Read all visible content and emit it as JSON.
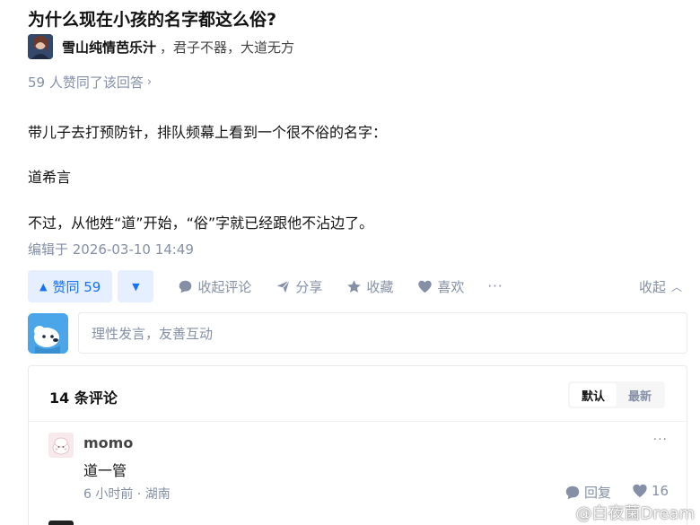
{
  "question": {
    "title": "为什么现在小孩的名字都这么俗?"
  },
  "author": {
    "name": "雪山纯情芭乐汁",
    "bio": "，君子不器，大道无方"
  },
  "answer": {
    "upvote_summary": "59 人赞同了该回答",
    "paragraphs": [
      "带儿子去打预防针，排队频幕上看到一个很不俗的名字：",
      "道希言",
      "不过，从他姓“道”开始，“俗”字就已经跟他不沾边了。"
    ],
    "edited": "编辑于 2026-03-10 14:49"
  },
  "actions": {
    "upvote_label": "赞同 59",
    "comments_label": "收起评论",
    "share_label": "分享",
    "collect_label": "收藏",
    "like_label": "喜欢",
    "more_label": "···",
    "collapse_label": "收起"
  },
  "comment_box": {
    "placeholder": "理性发言，友善互动"
  },
  "comments": {
    "count_label": "14 条评论",
    "sort_options": [
      "默认",
      "最新"
    ],
    "items": [
      {
        "user": "momo",
        "text": "道一管",
        "meta": "6 小时前 · 湖南",
        "reply_label": "回复",
        "likes": "16"
      }
    ]
  },
  "watermark": "@白夜菌Dream",
  "colors": {
    "accent": "#1772f6",
    "accent_bg": "#e5efff",
    "muted": "#8590a6"
  }
}
